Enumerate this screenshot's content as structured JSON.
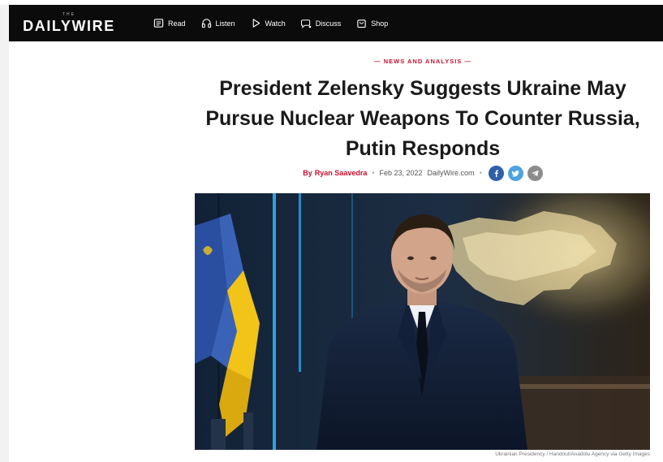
{
  "site": {
    "logo_top": "THE",
    "logo_word": "DAILYWIRE"
  },
  "nav": {
    "items": [
      {
        "label": "Read",
        "icon": "read-icon"
      },
      {
        "label": "Listen",
        "icon": "headphones-icon"
      },
      {
        "label": "Watch",
        "icon": "play-icon"
      },
      {
        "label": "Discuss",
        "icon": "chat-icon"
      },
      {
        "label": "Shop",
        "icon": "shopping-bag-icon"
      }
    ]
  },
  "article": {
    "kicker": "— NEWS AND ANALYSIS —",
    "headline_lines": [
      "President Zelensky Suggests Ukraine May",
      "Pursue Nuclear Weapons To Counter Russia,",
      "Putin Responds"
    ],
    "byline": {
      "by": "By",
      "author": "Ryan Saavedra",
      "date": "Feb 23, 2022",
      "source": "DailyWire.com"
    },
    "share": [
      "facebook-icon",
      "twitter-icon",
      "telegram-icon"
    ],
    "image_caption": "Ukrainian Presidency / Handout/Anadolu Agency via Getty Images"
  },
  "colors": {
    "nav_bg": "#0b0b0b",
    "accent_red": "#c8102e",
    "facebook": "#2f5fa8",
    "twitter": "#4da3e0",
    "telegram": "#8c8c8c"
  }
}
